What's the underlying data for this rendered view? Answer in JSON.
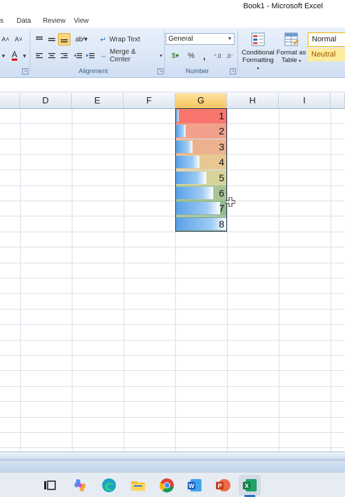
{
  "window": {
    "title": "Book1 - Microsoft Excel"
  },
  "tabs": [
    "s",
    "Data",
    "Review",
    "View"
  ],
  "ribbon": {
    "wrap_text": "Wrap Text",
    "merge_center": "Merge & Center",
    "number_format": "General",
    "currency_sym": "%",
    "comma_sym": ",",
    "cond_format_line1": "Conditional",
    "cond_format_line2": "Formatting",
    "format_table_line1": "Format as",
    "format_table_line2": "Table",
    "style_normal": "Normal",
    "style_neutral": "Neutral",
    "group_alignment": "Alignment",
    "group_number": "Number"
  },
  "grid": {
    "columns": [
      "D",
      "E",
      "F",
      "G",
      "H",
      "I"
    ],
    "selected_column": "G",
    "g_values": [
      "1",
      "2",
      "3",
      "4",
      "5",
      "6",
      "7",
      "8"
    ],
    "bar_fractions": [
      0.05,
      0.19,
      0.33,
      0.46,
      0.6,
      0.74,
      0.87,
      1.0
    ],
    "color_scale": [
      "#f8766d",
      "#f0a08b",
      "#ecb28f",
      "#e8c892",
      "#d6d49a",
      "#a9c597",
      "#91bb8f",
      "#82b386"
    ]
  },
  "colors": {
    "accent": "#f8c45e",
    "ribbon": "#dbe7f6"
  },
  "taskbar": {
    "icons": [
      "task-view-icon",
      "copilot-icon",
      "edge-icon",
      "file-explorer-icon",
      "chrome-icon",
      "word-icon",
      "powerpoint-icon",
      "excel-icon"
    ]
  }
}
